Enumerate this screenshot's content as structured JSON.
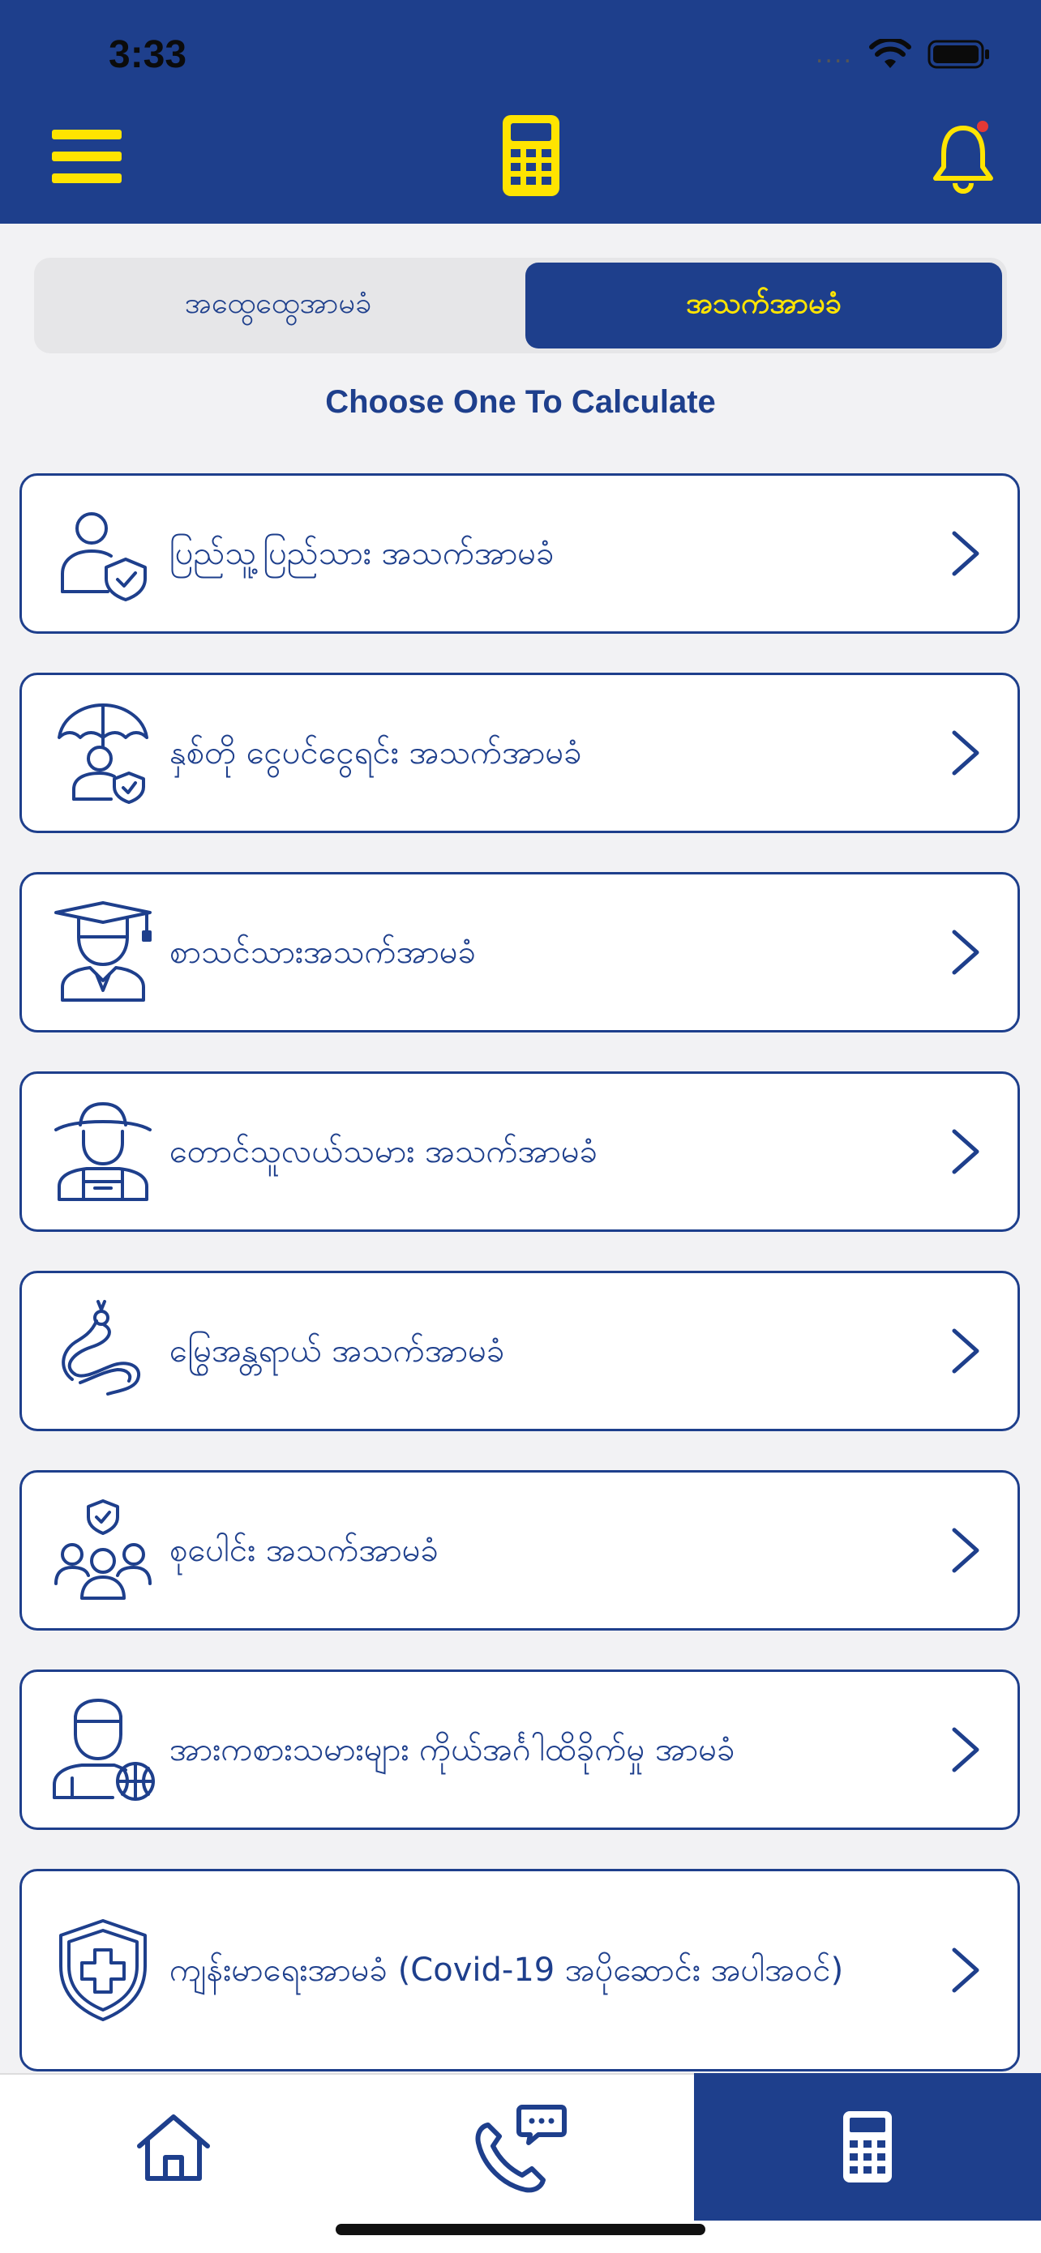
{
  "status_bar": {
    "time": "3:33",
    "cellular": "....",
    "wifi_icon": "wifi-icon",
    "battery_icon": "battery-icon"
  },
  "header": {
    "menu_icon": "hamburger-menu-icon",
    "center_icon": "calculator-icon",
    "notification_icon": "bell-icon"
  },
  "segment": {
    "left_label": "အထွေထွေအာမခံ",
    "right_label": "အသက်အာမခံ",
    "selected": "right"
  },
  "heading": "Choose One To Calculate",
  "items": [
    {
      "label": "ပြည်သူ့ပြည်သား အသက်အာမခံ",
      "icon": "person-shield-icon"
    },
    {
      "label": "နှစ်တို ငွေပင်ငွေရင်း အသက်အာမခံ",
      "icon": "umbrella-person-icon"
    },
    {
      "label": "စာသင်သားအသက်အာမခံ",
      "icon": "graduate-student-icon"
    },
    {
      "label": "တောင်သူလယ်သမား အသက်အာမခံ",
      "icon": "farmer-icon"
    },
    {
      "label": "မြွေအန္တရာယ် အသက်အာမခံ",
      "icon": "snake-icon"
    },
    {
      "label": "စုပေါင်း အသက်အာမခံ",
      "icon": "group-shield-icon"
    },
    {
      "label": "အားကစားသမားများ ကိုယ်အင်္ဂါထိခိုက်မှု အာမခံ",
      "icon": "athlete-basketball-icon"
    },
    {
      "label": "ကျန်းမာရေးအာမခံ (Covid-19 အပိုဆောင်း အပါအဝင်)",
      "icon": "health-shield-cross-icon"
    }
  ],
  "bottom_nav": {
    "tabs": [
      {
        "name": "home",
        "icon": "home-icon"
      },
      {
        "name": "contact",
        "icon": "phone-chat-icon"
      },
      {
        "name": "calculator",
        "icon": "calculator-icon",
        "active": true
      }
    ]
  },
  "colors": {
    "primary": "#1e3f8c",
    "accent": "#ffe400",
    "background": "#f2f2f4",
    "badge": "#e53935"
  }
}
